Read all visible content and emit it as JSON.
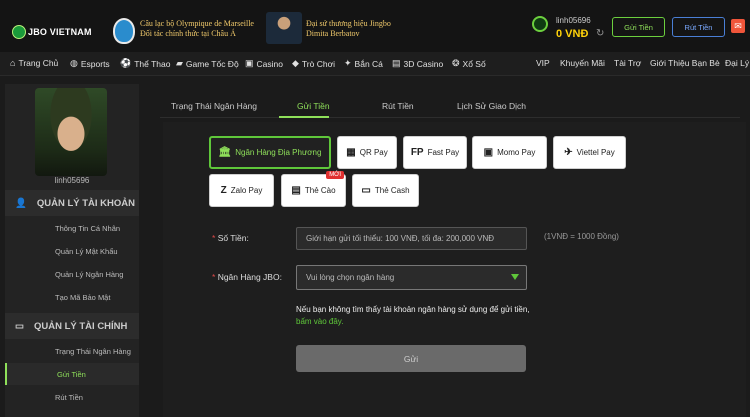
{
  "header": {
    "logo_text": "JBO VIETNAM",
    "sponsor1_line1": "Câu lạc bộ Olympique de Marseille",
    "sponsor1_line2": "Đối tác chính thức tại Châu Á",
    "sponsor2_line1": "Đại sứ thương hiệu Jingbo",
    "sponsor2_line2": "Dimita Berbatov",
    "username": "linh05696",
    "balance": "0  VNĐ",
    "deposit_label": "Gửi Tiền",
    "withdraw_label": "Rút Tiền",
    "mail_icon": "mail-icon"
  },
  "nav": {
    "items": [
      {
        "label": "Trang Chủ",
        "icon": "home-icon"
      },
      {
        "label": "Esports",
        "icon": "gamepad-icon"
      },
      {
        "label": "Thể Thao",
        "icon": "ball-icon"
      },
      {
        "label": "Game Tốc Độ",
        "icon": "car-icon"
      },
      {
        "label": "Casino",
        "icon": "slot-icon"
      },
      {
        "label": "Trò Chơi",
        "icon": "game-icon"
      },
      {
        "label": "Bắn Cá",
        "icon": "fish-icon"
      },
      {
        "label": "3D Casino",
        "icon": "cube-icon"
      },
      {
        "label": "Xổ Số",
        "icon": "lottery-icon"
      }
    ],
    "right_items": [
      "VIP",
      "Khuyến Mãi",
      "Tài Trợ",
      "Giới Thiệu Bạn Bè",
      "Đại Lý"
    ]
  },
  "sidebar": {
    "username": "linh05696",
    "account_title": "QUẢN LÝ TÀI KHOẢN",
    "account_items": [
      "Thông Tin Cá Nhân",
      "Quản Lý Mật Khẩu",
      "Quản Lý Ngân Hàng",
      "Tạo Mã Bảo Mật"
    ],
    "finance_title": "QUẢN LÝ TÀI CHÍNH",
    "finance_items": [
      "Trạng Thái Ngân Hàng",
      "Gửi Tiền",
      "Rút Tiền"
    ]
  },
  "tabs": [
    "Trạng Thái Ngân Hàng",
    "Gửi Tiền",
    "Rút Tiền",
    "Lịch Sử Giao Dịch"
  ],
  "payment_methods": [
    {
      "label": "Ngân Hàng Địa Phương",
      "icon": "bank-icon"
    },
    {
      "label": "QR Pay",
      "icon": "qr-icon"
    },
    {
      "label": "Fast Pay",
      "icon": "fastpay-icon"
    },
    {
      "label": "Momo Pay",
      "icon": "momo-icon"
    },
    {
      "label": "Viettel Pay",
      "icon": "viettel-icon"
    },
    {
      "label": "Zalo Pay",
      "icon": "zalo-icon"
    },
    {
      "label": "Thẻ Cào",
      "icon": "card-icon",
      "badge": "MỚI"
    },
    {
      "label": "Thẻ Cash",
      "icon": "cash-card-icon"
    }
  ],
  "form": {
    "amount_label": "Số Tiền:",
    "amount_placeholder": "Giới hạn gửi tối thiểu: 100 VNĐ, tối đa: 200,000 VNĐ",
    "rate_text": "(1VNĐ = 1000 Đồng)",
    "bank_label": "Ngân Hàng JBO:",
    "bank_placeholder": "Vui lòng chọn ngân hàng",
    "note_text": "Nếu bạn không tìm thấy tài khoản ngân hàng sử dụng để gửi tiền, ",
    "note_link": "bấm vào đây.",
    "submit_label": "Gửi"
  },
  "colors": {
    "accent": "#8fe05a",
    "balance": "#ffd20a",
    "background": "#1b1b1b"
  }
}
